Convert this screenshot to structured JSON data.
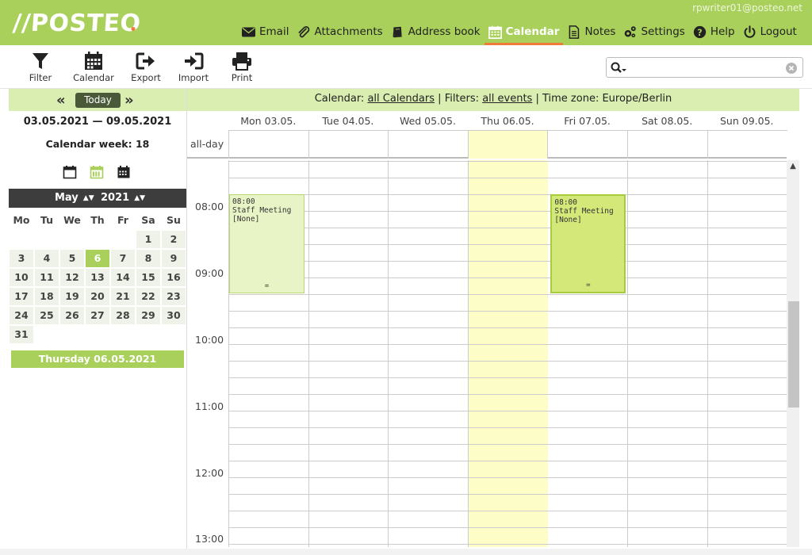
{
  "header": {
    "logo": "//POSTEO",
    "user_email": "rpwriter01@posteo.net",
    "nav": [
      {
        "label": "Email",
        "icon": "envelope-icon"
      },
      {
        "label": "Attachments",
        "icon": "paperclip-icon"
      },
      {
        "label": "Address book",
        "icon": "book-icon"
      },
      {
        "label": "Calendar",
        "icon": "calendar-icon",
        "active": true
      },
      {
        "label": "Notes",
        "icon": "note-icon"
      },
      {
        "label": "Settings",
        "icon": "gears-icon"
      },
      {
        "label": "Help",
        "icon": "help-icon"
      },
      {
        "label": "Logout",
        "icon": "power-icon"
      }
    ]
  },
  "toolbar": {
    "filter": "Filter",
    "calendar": "Calendar",
    "export": "Export",
    "import": "Import",
    "print": "Print",
    "search_value": ""
  },
  "sidebar": {
    "today": "Today",
    "date_range": "03.05.2021 — 09.05.2021",
    "calendar_week": "Calendar week: 18",
    "month": "May",
    "year": "2021",
    "weekdays": [
      "Mo",
      "Tu",
      "We",
      "Th",
      "Fr",
      "Sa",
      "Su"
    ],
    "weeks": [
      [
        "",
        "",
        "",
        "",
        "",
        "1",
        "2"
      ],
      [
        "3",
        "4",
        "5",
        "6",
        "7",
        "8",
        "9"
      ],
      [
        "10",
        "11",
        "12",
        "13",
        "14",
        "15",
        "16"
      ],
      [
        "17",
        "18",
        "19",
        "20",
        "21",
        "22",
        "23"
      ],
      [
        "24",
        "25",
        "26",
        "27",
        "28",
        "29",
        "30"
      ],
      [
        "31",
        "",
        "",
        "",
        "",
        "",
        ""
      ]
    ],
    "today_day": "6",
    "selected_date": "Thursday 06.05.2021"
  },
  "infobar": {
    "calendar_label": "Calendar:",
    "calendar_link": "all Calendars",
    "sep1": "|",
    "filters_label": "Filters:",
    "filters_link": "all events",
    "sep2": "|",
    "timezone": "Time zone: Europe/Berlin"
  },
  "days": [
    "Mon 03.05.",
    "Tue 04.05.",
    "Wed 05.05.",
    "Thu 06.05.",
    "Fri 07.05.",
    "Sat 08.05.",
    "Sun 09.05."
  ],
  "allday_label": "all-day",
  "times": [
    "08:00",
    "09:00",
    "10:00",
    "11:00",
    "12:00",
    "13:00"
  ],
  "events": [
    {
      "day": 0,
      "time": "08:00",
      "title": "Staff Meeting",
      "calendar": "[None]"
    },
    {
      "day": 4,
      "time": "08:00",
      "title": "Staff Meeting",
      "calendar": "[None]"
    }
  ],
  "colors": {
    "header": "#a8d05a",
    "accent": "#f07a3a",
    "info_bar": "#d9eeb0",
    "today_column": "#fdfdc8"
  }
}
